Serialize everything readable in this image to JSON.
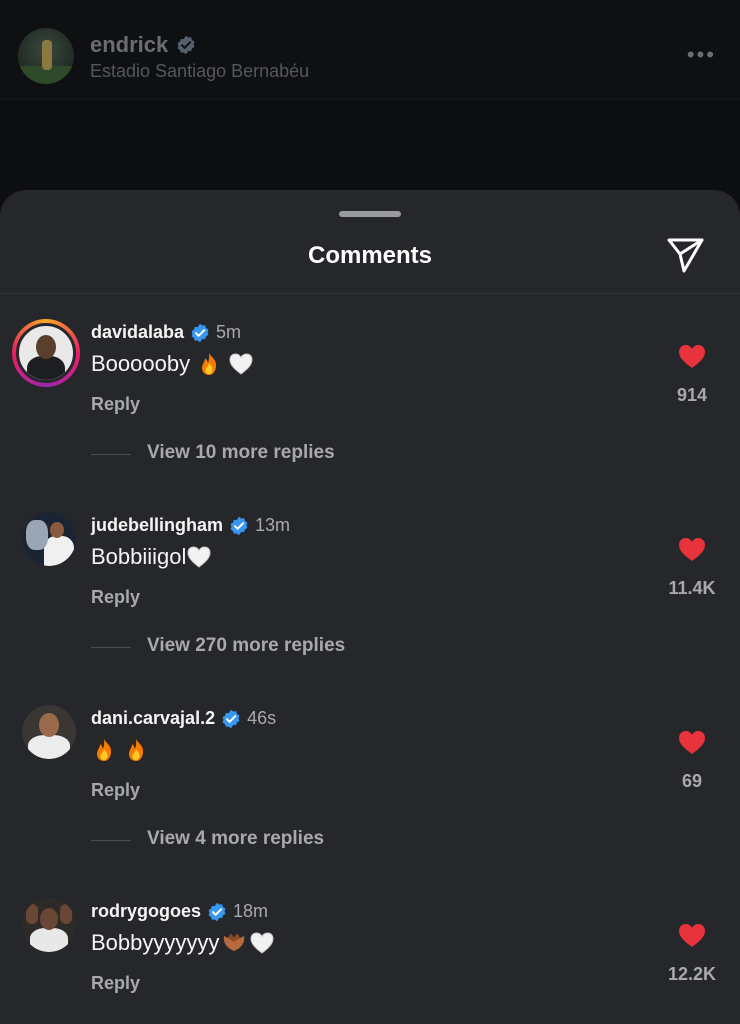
{
  "post": {
    "username": "endrick",
    "location": "Estadio Santiago Bernabéu",
    "more_icon": "more-horizontal-icon"
  },
  "sheet": {
    "title": "Comments",
    "share_icon": "paper-plane-icon"
  },
  "colors": {
    "sheet_bg": "#26272b",
    "heart": "#e8323c",
    "verified": "#3897f0",
    "muted": "#a8a9ad"
  },
  "comments": [
    {
      "username": "davidalaba",
      "time": "5m",
      "text": "Boooooby",
      "emojis": [
        "fire-emoji",
        "white-heart-emoji"
      ],
      "reply_label": "Reply",
      "view_replies": "View 10 more replies",
      "likes": "914"
    },
    {
      "username": "judebellingham",
      "time": "13m",
      "text": "Bobbiiigol",
      "emojis": [
        "white-heart-emoji"
      ],
      "reply_label": "Reply",
      "view_replies": "View 270 more replies",
      "likes": "11.4K"
    },
    {
      "username": "dani.carvajal.2",
      "time": "46s",
      "text": "",
      "emojis": [
        "fire-emoji",
        "fire-emoji"
      ],
      "reply_label": "Reply",
      "view_replies": "View 4 more replies",
      "likes": "69"
    },
    {
      "username": "rodrygogoes",
      "time": "18m",
      "text": "Bobbyyyyyyy",
      "emojis": [
        "heart-hands-emoji",
        "white-heart-emoji"
      ],
      "reply_label": "Reply",
      "view_replies": "",
      "likes": "12.2K"
    }
  ]
}
